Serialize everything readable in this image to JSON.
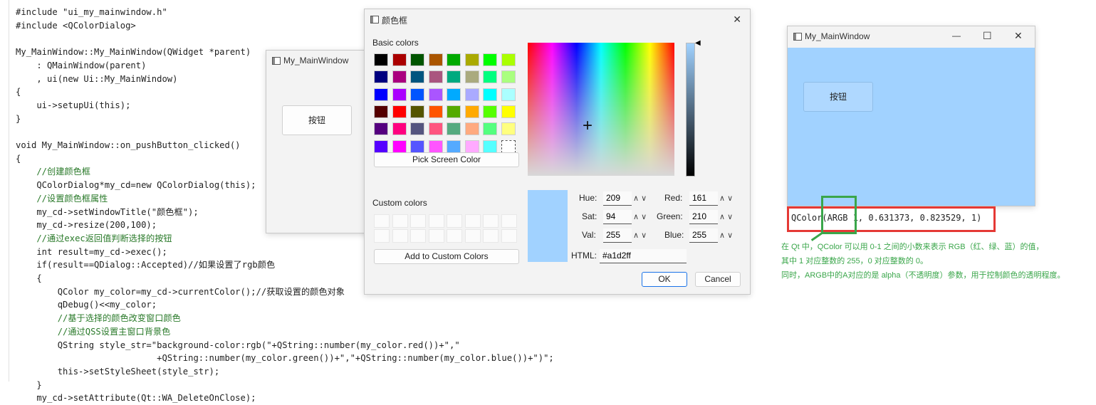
{
  "code": {
    "lines": [
      "#include \"ui_my_mainwindow.h\"",
      "#include <QColorDialog>",
      "",
      "My_MainWindow::My_MainWindow(QWidget *parent)",
      "    : QMainWindow(parent)",
      "    , ui(new Ui::My_MainWindow)",
      "{",
      "    ui->setupUi(this);",
      "}",
      "",
      "void My_MainWindow::on_pushButton_clicked()",
      "{",
      "    //创建颜色框",
      "    QColorDialog*my_cd=new QColorDialog(this);",
      "    //设置颜色框属性",
      "    my_cd->setWindowTitle(\"颜色框\");",
      "    my_cd->resize(200,100);",
      "    //通过exec返回值判断选择的按钮",
      "    int result=my_cd->exec();",
      "    if(result==QDialog::Accepted)//如果设置了rgb颜色",
      "    {",
      "        QColor my_color=my_cd->currentColor();//获取设置的颜色对象",
      "        qDebug()<<my_color;",
      "        //基于选择的颜色改变窗口颜色",
      "        //通过QSS设置主窗口背景色",
      "        QString style_str=\"background-color:rgb(\"+QString::number(my_color.red())+\",\"",
      "                           +QString::number(my_color.green())+\",\"+QString::number(my_color.blue())+\")\";",
      "        this->setStyleSheet(style_str);",
      "    }",
      "    my_cd->setAttribute(Qt::WA_DeleteOnClose);"
    ]
  },
  "small_window": {
    "title": "My_MainWindow",
    "button_label": "按钮"
  },
  "color_dialog": {
    "title": "颜色框",
    "close_glyph": "✕",
    "basic_colors_label": "Basic colors",
    "basic_colors": [
      "#000000",
      "#aa0000",
      "#005500",
      "#aa5500",
      "#00aa00",
      "#aaaa00",
      "#00ff00",
      "#aaff00",
      "#00007f",
      "#aa007f",
      "#00557f",
      "#aa557f",
      "#00aa7f",
      "#aaaa7f",
      "#00ff7f",
      "#aaff7f",
      "#0000ff",
      "#aa00ff",
      "#0055ff",
      "#aa55ff",
      "#00aaff",
      "#aaaaff",
      "#00ffff",
      "#aaffff",
      "#550000",
      "#ff0000",
      "#555500",
      "#ff5500",
      "#55aa00",
      "#ffaa00",
      "#55ff00",
      "#ffff00",
      "#55007f",
      "#ff007f",
      "#55557f",
      "#ff557f",
      "#55aa7f",
      "#ffaa7f",
      "#55ff7f",
      "#ffff7f",
      "#5500ff",
      "#ff00ff",
      "#5555ff",
      "#ff55ff",
      "#55aaff",
      "#ffaaff",
      "#55ffff",
      "#ffffff"
    ],
    "pick_screen_label": "Pick Screen Color",
    "custom_colors_label": "Custom colors",
    "add_custom_label": "Add to Custom Colors",
    "preview_color": "#a1d2ff",
    "hue_label": "Hue:",
    "hue_value": "209",
    "sat_label": "Sat:",
    "sat_value": "94",
    "val_label": "Val:",
    "val_value": "255",
    "red_label": "Red:",
    "red_value": "161",
    "green_label": "Green:",
    "green_value": "210",
    "blue_label": "Blue:",
    "blue_value": "255",
    "html_label": "HTML:",
    "html_value": "#a1d2ff",
    "ok_label": "OK",
    "cancel_label": "Cancel"
  },
  "right_window": {
    "title": "My_MainWindow",
    "minimize_glyph": "—",
    "maximize_glyph": "☐",
    "close_glyph": "✕",
    "button_label": "按钮",
    "bg_color": "#a1d2ff",
    "debug_output": "QColor(ARGB 1, 0.631373, 0.823529, 1)"
  },
  "annotation": {
    "lines": [
      "在 Qt 中，QColor 可以用 0-1 之间的小数来表示 RGB（红、绿、蓝）的值，",
      "其中 1 对应整数的 255，0 对应整数的 0。",
      "同时，ARGB中的A对应的是 alpha（不透明度）参数，用于控制颜色的透明程度。"
    ],
    "highlight_red": "#e53935",
    "highlight_green": "#3aa64a"
  }
}
